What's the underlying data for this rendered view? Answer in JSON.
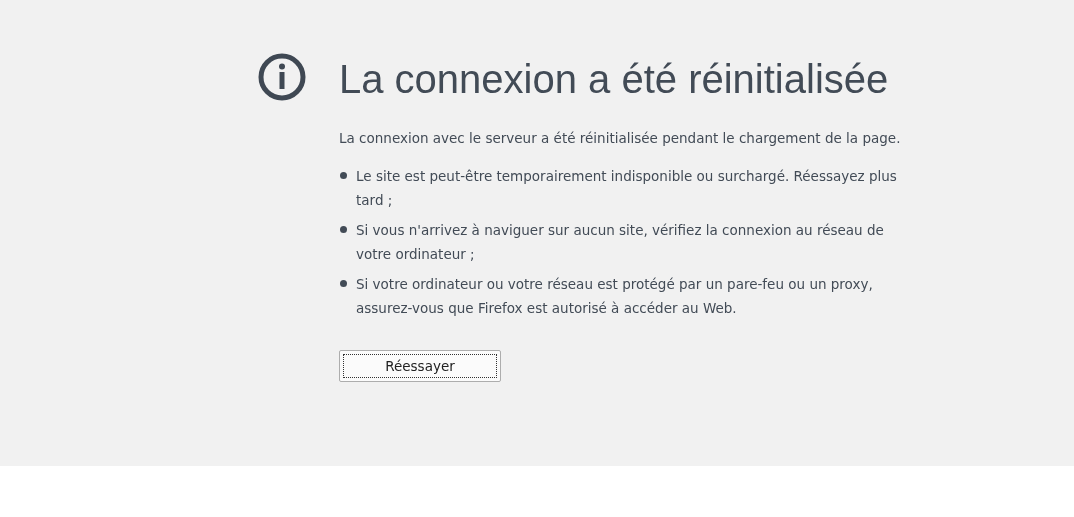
{
  "title": "La connexion a été réinitialisée",
  "description": "La connexion avec le serveur a été réinitialisée pendant le chargement de la page.",
  "suggestions": [
    "Le site est peut-être temporairement indisponible ou surchargé. Réessayez plus tard ;",
    "Si vous n'arrivez à naviguer sur aucun site, vérifiez la connexion au réseau de votre ordinateur ;",
    "Si votre ordinateur ou votre réseau est protégé par un pare-feu ou un proxy, assurez-vous que Firefox est autorisé à accéder au Web."
  ],
  "retry_button": "Réessayer"
}
